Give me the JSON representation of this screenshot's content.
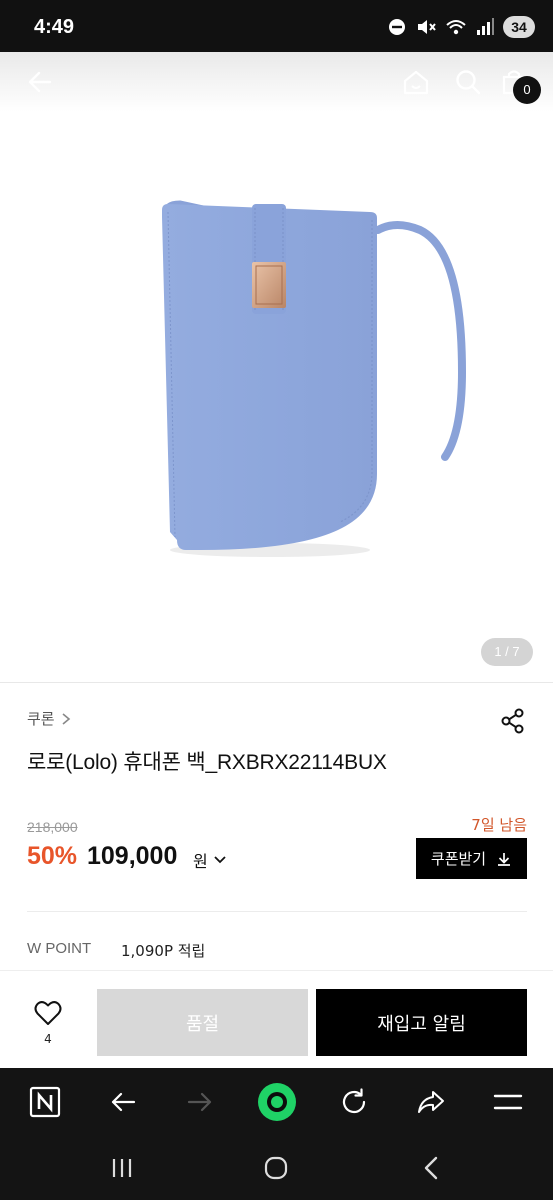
{
  "status_bar": {
    "time": "4:49",
    "battery": "34",
    "icons": [
      "do-not-disturb-icon",
      "mute-icon",
      "wifi-icon",
      "signal-icon"
    ]
  },
  "header": {
    "icons": [
      "back-arrow-icon",
      "home-icon",
      "search-icon",
      "cart-icon"
    ],
    "cart_count": "0"
  },
  "gallery": {
    "counter": "1 / 7",
    "image_subject": "lavender-blue leather phone crossbody bag"
  },
  "product": {
    "brand": "쿠론",
    "title": "로로(Lolo) 휴대폰 백_RXBRX22114BUX",
    "original_price": "218,000",
    "days_left": "7일 남음",
    "discount": "50%",
    "price": "109,000",
    "currency": "원",
    "coupon_label": "쿠폰받기"
  },
  "points": {
    "label": "W POINT",
    "value": "1,090P 적립"
  },
  "actions": {
    "like_count": "4",
    "soldout_label": "품절",
    "restock_label": "재입고 알림"
  },
  "browser_bar": {
    "icons": [
      "naver-n-icon",
      "back-icon",
      "forward-icon",
      "green-dot-icon",
      "reload-icon",
      "share-icon",
      "menu-icon"
    ]
  },
  "system_nav": {
    "icons": [
      "recents-icon",
      "home-circle-icon",
      "back-chevron-icon"
    ]
  },
  "colors": {
    "accent_discount": "#e8552a",
    "days_left": "#d2572b",
    "bag": "#8fa8de",
    "button_dark": "#000000",
    "button_disabled": "#d8d8d8",
    "green_dot": "#1fd266"
  }
}
